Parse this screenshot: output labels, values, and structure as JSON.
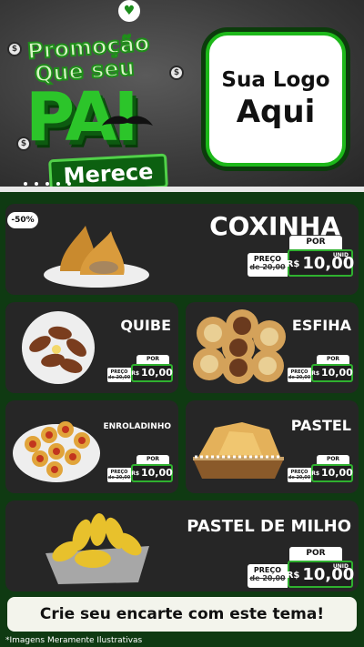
{
  "header": {
    "promo_line1": "Promoção",
    "promo_line2": "Que seu",
    "promo_pai": "PAI",
    "promo_merece": "Merece",
    "logo_line1": "Sua Logo",
    "logo_line2": "Aqui"
  },
  "colors": {
    "accent": "#2cc52a",
    "card": "#262626",
    "background": "#0f3a12"
  },
  "discount_badge": "-50%",
  "products": {
    "coxinha": {
      "name": "COXINHA",
      "por": "POR",
      "preco": "PREÇO",
      "old": "de 20,00",
      "rs": "R$",
      "value": "10,00",
      "unid": "UNID"
    },
    "quibe": {
      "name": "QUIBE",
      "por": "POR",
      "preco": "PREÇO",
      "old": "de 20,00",
      "rs": "R$",
      "value": "10,00"
    },
    "esfiha": {
      "name": "ESFIHA",
      "por": "POR",
      "preco": "PREÇO",
      "old": "de 20,00",
      "rs": "R$",
      "value": "10,00"
    },
    "enroladinho": {
      "name": "ENROLADINHO",
      "por": "POR",
      "preco": "PREÇO",
      "old": "de 20,00",
      "rs": "R$",
      "value": "10,00"
    },
    "pastel": {
      "name": "PASTEL",
      "por": "POR",
      "preco": "PREÇO",
      "old": "de 20,00",
      "rs": "R$",
      "value": "10,00"
    },
    "pastel_milho": {
      "name": "PASTEL DE MILHO",
      "por": "POR",
      "preco": "PREÇO",
      "old": "de 20,00",
      "rs": "R$",
      "value": "10,00",
      "unid": "UNID"
    }
  },
  "cta": "Crie seu encarte com este tema!",
  "disclaimer": "*Imagens Meramente Ilustrativas"
}
